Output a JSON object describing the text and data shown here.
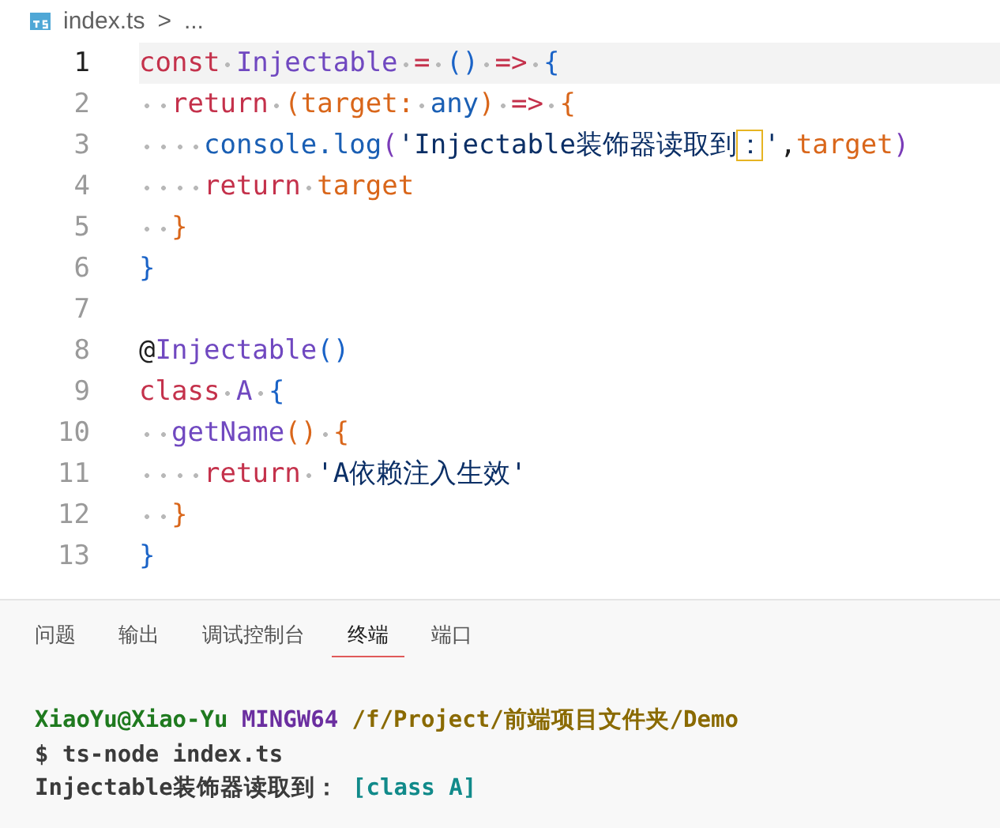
{
  "breadcrumb": {
    "file": "index.ts",
    "separator": ">",
    "rest": "..."
  },
  "editor": {
    "lines": [
      {
        "number": "1",
        "active": true,
        "tokens": [
          {
            "kind": "kw",
            "text": "const "
          },
          {
            "kind": "fn",
            "text": "Injectable "
          },
          {
            "kind": "op",
            "text": "= "
          },
          {
            "kind": "b1",
            "text": "() "
          },
          {
            "kind": "op",
            "text": "=> "
          },
          {
            "kind": "b1",
            "text": "{"
          }
        ]
      },
      {
        "number": "2",
        "active": false,
        "tokens": [
          {
            "kind": "kw",
            "text": "  return "
          },
          {
            "kind": "b2",
            "text": "("
          },
          {
            "kind": "var",
            "text": "target: "
          },
          {
            "kind": "type",
            "text": "any"
          },
          {
            "kind": "b2",
            "text": ") "
          },
          {
            "kind": "op",
            "text": "=> "
          },
          {
            "kind": "b2",
            "text": "{"
          }
        ]
      },
      {
        "number": "3",
        "active": false,
        "tokens": [
          {
            "kind": "type",
            "text": "    console.log"
          },
          {
            "kind": "b3",
            "text": "("
          },
          {
            "kind": "str",
            "text": "'Injectable装饰器读取到"
          },
          {
            "kind": "hl",
            "text": "："
          },
          {
            "kind": "str",
            "text": "'"
          },
          {
            "kind": "plain",
            "text": ","
          },
          {
            "kind": "var",
            "text": "target"
          },
          {
            "kind": "b3",
            "text": ")"
          }
        ]
      },
      {
        "number": "4",
        "active": false,
        "tokens": [
          {
            "kind": "kw",
            "text": "    return "
          },
          {
            "kind": "var",
            "text": "target"
          }
        ]
      },
      {
        "number": "5",
        "active": false,
        "tokens": [
          {
            "kind": "b2",
            "text": "  }"
          }
        ]
      },
      {
        "number": "6",
        "active": false,
        "tokens": [
          {
            "kind": "b1",
            "text": "}"
          }
        ]
      },
      {
        "number": "7",
        "active": false
      },
      {
        "number": "8",
        "active": false,
        "tokens": [
          {
            "kind": "plain",
            "text": "@"
          },
          {
            "kind": "fn",
            "text": "Injectable"
          },
          {
            "kind": "b1",
            "text": "()"
          }
        ]
      },
      {
        "number": "9",
        "active": false,
        "tokens": [
          {
            "kind": "kw",
            "text": "class "
          },
          {
            "kind": "fn",
            "text": "A "
          },
          {
            "kind": "b1",
            "text": "{"
          }
        ]
      },
      {
        "number": "10",
        "active": false,
        "tokens": [
          {
            "kind": "fn",
            "text": "  getName"
          },
          {
            "kind": "b2",
            "text": "() "
          },
          {
            "kind": "b2",
            "text": "{"
          }
        ]
      },
      {
        "number": "11",
        "active": false,
        "tokens": [
          {
            "kind": "kw",
            "text": "    return "
          },
          {
            "kind": "str",
            "text": "'A依赖注入生效'"
          }
        ]
      },
      {
        "number": "12",
        "active": false,
        "tokens": [
          {
            "kind": "b2",
            "text": "  }"
          }
        ]
      },
      {
        "number": "13",
        "active": false,
        "tokens": [
          {
            "kind": "b1",
            "text": "}"
          }
        ]
      }
    ]
  },
  "panel": {
    "tabs": [
      {
        "label": "问题",
        "selected": false
      },
      {
        "label": "输出",
        "selected": false
      },
      {
        "label": "调试控制台",
        "selected": false
      },
      {
        "label": "终端",
        "selected": true
      },
      {
        "label": "端口",
        "selected": false
      }
    ],
    "terminal": [
      [
        {
          "kind": "user",
          "text": "XiaoYu@Xiao-Yu "
        },
        {
          "kind": "sys",
          "text": "MINGW64 "
        },
        {
          "kind": "path",
          "text": "/f/Project/前端项目文件夹/Demo"
        }
      ],
      [
        {
          "kind": "plain",
          "text": "$ ts-node index.ts"
        }
      ],
      [
        {
          "kind": "plain",
          "text": "Injectable装饰器读取到： "
        },
        {
          "kind": "cls",
          "text": "[class A]"
        }
      ]
    ]
  }
}
